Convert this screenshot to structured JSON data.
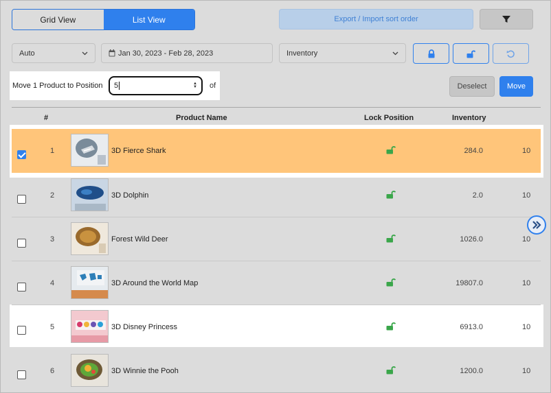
{
  "view_toggle": {
    "grid": "Grid View",
    "list": "List View"
  },
  "toolbar": {
    "export_label": "Export / Import sort order",
    "filter_icon": "filter-icon"
  },
  "filters": {
    "sort_mode": "Auto",
    "date_range": "Jan 30, 2023 - Feb 28, 2023",
    "metric": "Inventory",
    "icons": [
      "lock-icon",
      "unlock-icon",
      "undo-icon"
    ]
  },
  "move_bar": {
    "label": "Move 1 Product to Position",
    "position_value": "5",
    "of_label": "of",
    "deselect": "Deselect",
    "move": "Move"
  },
  "table": {
    "headers": {
      "index": "#",
      "name": "Product Name",
      "lock": "Lock Position",
      "inventory": "Inventory"
    },
    "rows": [
      {
        "index": "1",
        "name": "3D Fierce Shark",
        "inventory": "284.0",
        "extra": "10",
        "checked": true
      },
      {
        "index": "2",
        "name": "3D Dolphin",
        "inventory": "2.0",
        "extra": "10",
        "checked": false
      },
      {
        "index": "3",
        "name": "Forest Wild Deer",
        "inventory": "1026.0",
        "extra": "10",
        "checked": false
      },
      {
        "index": "4",
        "name": "3D Around the World Map",
        "inventory": "19807.0",
        "extra": "10",
        "checked": false
      },
      {
        "index": "5",
        "name": "3D Disney Princess",
        "inventory": "6913.0",
        "extra": "10",
        "checked": false
      },
      {
        "index": "6",
        "name": "3D Winnie the Pooh",
        "inventory": "1200.0",
        "extra": "10",
        "checked": false
      }
    ]
  },
  "colors": {
    "accent": "#2f80ed",
    "selected_row": "#ffc57a",
    "lock_green": "#3aa64a"
  }
}
